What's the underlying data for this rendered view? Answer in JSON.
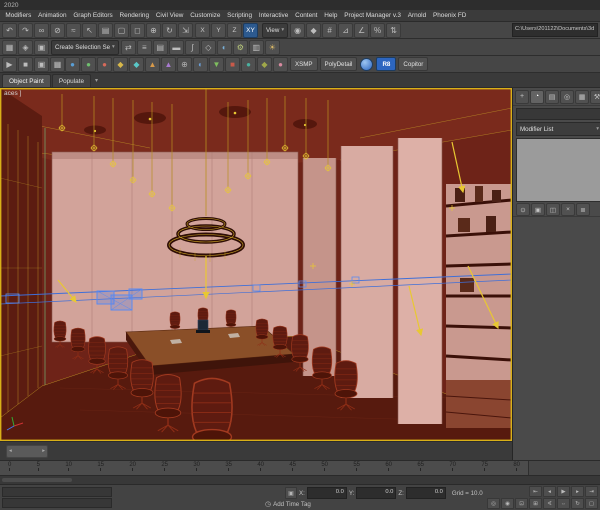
{
  "colors": {
    "viewport_border": "#d8b018",
    "selection_blue": "#4a7de0",
    "light_helper_yellow": "#e8c832",
    "axis_active_blue": "#2d5a8f",
    "wall_red": "#6e2318",
    "wall_pink": "#d2a39a"
  },
  "icons": {
    "chevron_down": "▾",
    "clock": "◷",
    "lock_toggle": "▣"
  },
  "window": {
    "title_fragment": "2020"
  },
  "menubar": {
    "items": [
      {
        "name": "menu-modifiers",
        "label": "Modifiers"
      },
      {
        "name": "menu-animation",
        "label": "Animation"
      },
      {
        "name": "menu-graph-editors",
        "label": "Graph Editors"
      },
      {
        "name": "menu-rendering",
        "label": "Rendering"
      },
      {
        "name": "menu-civil-view",
        "label": "Civil View"
      },
      {
        "name": "menu-customize",
        "label": "Customize"
      },
      {
        "name": "menu-scripting",
        "label": "Scripting"
      },
      {
        "name": "menu-interactive",
        "label": "Interactive"
      },
      {
        "name": "menu-content",
        "label": "Content"
      },
      {
        "name": "menu-help",
        "label": "Help"
      },
      {
        "name": "menu-project-manager",
        "label": "Project Manager v.3"
      },
      {
        "name": "menu-arnold",
        "label": "Arnold"
      },
      {
        "name": "menu-phoenix-fd",
        "label": "Phoenix FD"
      }
    ]
  },
  "toolbar1": {
    "icons_a": [
      {
        "name": "undo-icon",
        "glyph": "↶"
      },
      {
        "name": "redo-icon",
        "glyph": "↷"
      },
      {
        "name": "select-and-link-icon",
        "glyph": "∞"
      },
      {
        "name": "unlink-selection-icon",
        "glyph": "⊘"
      },
      {
        "name": "bind-to-space-warp-icon",
        "glyph": "≈"
      },
      {
        "name": "select-object-icon",
        "glyph": "↖"
      },
      {
        "name": "select-by-name-icon",
        "glyph": "▤"
      },
      {
        "name": "rectangular-selection-icon",
        "glyph": "▢"
      },
      {
        "name": "window-crossing-icon",
        "glyph": "◻"
      },
      {
        "name": "select-and-move-icon",
        "glyph": "⊕"
      },
      {
        "name": "select-and-rotate-icon",
        "glyph": "↻"
      },
      {
        "name": "select-and-scale-icon",
        "glyph": "⇲"
      }
    ],
    "axis_buttons": [
      {
        "name": "axis-constraint-x",
        "label": "X"
      },
      {
        "name": "axis-constraint-y",
        "label": "Y"
      },
      {
        "name": "axis-constraint-z",
        "label": "Z"
      },
      {
        "name": "axis-constraint-xy",
        "label": "XY",
        "active": true
      }
    ],
    "ref_coord_value": "View",
    "icons_b": [
      {
        "name": "use-pivot-point-icon",
        "glyph": "◉"
      },
      {
        "name": "select-and-manipulate-icon",
        "glyph": "◆"
      },
      {
        "name": "keyboard-override-icon",
        "glyph": "#"
      },
      {
        "name": "snaps-toggle-icon",
        "glyph": "⊿"
      },
      {
        "name": "angle-snap-icon",
        "glyph": "∠"
      },
      {
        "name": "percent-snap-icon",
        "glyph": "%"
      },
      {
        "name": "spinner-snap-icon",
        "glyph": "⇅"
      }
    ],
    "project_path": "C:\\Users\\201122\\Documents\\3d"
  },
  "toolbar2": {
    "icons_left": [
      {
        "name": "edit-named-selection-sets-icon",
        "glyph": "▦"
      },
      {
        "name": "isolate-selection-icon",
        "glyph": "◈"
      },
      {
        "name": "lock-selection-icon",
        "glyph": "▣"
      }
    ],
    "selection_set_value": "Create Selection Se",
    "icons_right": [
      {
        "name": "mirror-icon",
        "glyph": "⇄"
      },
      {
        "name": "align-icon",
        "glyph": "≡"
      },
      {
        "name": "layer-manager-icon",
        "glyph": "▤"
      },
      {
        "name": "ribbon-toggle-icon",
        "glyph": "▬"
      },
      {
        "name": "curve-editor-icon",
        "glyph": "∫"
      },
      {
        "name": "schematic-view-icon",
        "glyph": "◇"
      },
      {
        "name": "material-editor-icon",
        "glyph": "◐",
        "color": "#7ab0d8"
      },
      {
        "name": "render-setup-icon",
        "glyph": "⚙",
        "color": "#b8c87a"
      },
      {
        "name": "rendered-frame-window-icon",
        "glyph": "▥"
      },
      {
        "name": "render-production-icon",
        "glyph": "☀",
        "color": "#d8b868"
      }
    ]
  },
  "toolbar3": {
    "icons_left": [
      {
        "name": "play-animation-icon",
        "glyph": "▶"
      },
      {
        "name": "stop-animation-icon",
        "glyph": "■"
      },
      {
        "name": "snapshot-icon",
        "glyph": "▣"
      },
      {
        "name": "grid-toggle-icon",
        "glyph": "▦"
      }
    ],
    "macro_icons": [
      {
        "name": "macro-teapot-blue-icon",
        "glyph": "●",
        "color": "#5a9fd6"
      },
      {
        "name": "macro-teapot-green-icon",
        "glyph": "●",
        "color": "#6fbf6f"
      },
      {
        "name": "macro-teapot-red-icon",
        "glyph": "●",
        "color": "#d66a5a"
      },
      {
        "name": "macro-sphere-yellow-icon",
        "glyph": "◆",
        "color": "#d8b84a"
      },
      {
        "name": "macro-sphere-cyan-icon",
        "glyph": "◆",
        "color": "#5ac8c8"
      },
      {
        "name": "macro-cone-orange-icon",
        "glyph": "▲",
        "color": "#d89a4a"
      },
      {
        "name": "macro-cone-purple-icon",
        "glyph": "▲",
        "color": "#a87ad0"
      },
      {
        "name": "macro-tool-gray-icon",
        "glyph": "⊕",
        "color": "#b0b0b0"
      },
      {
        "name": "macro-tool-blue2-icon",
        "glyph": "◐",
        "color": "#6a9fd8"
      },
      {
        "name": "macro-tool-green2-icon",
        "glyph": "▼",
        "color": "#7fbf5f"
      },
      {
        "name": "macro-tool-red2-icon",
        "glyph": "■",
        "color": "#c85a4a"
      },
      {
        "name": "macro-tool-teal-icon",
        "glyph": "●",
        "color": "#4ab0a0"
      },
      {
        "name": "macro-tool-olive-icon",
        "glyph": "◆",
        "color": "#a0a84a"
      },
      {
        "name": "macro-tool-pink-icon",
        "glyph": "●",
        "color": "#d88aa0"
      }
    ],
    "plugin_buttons": [
      {
        "name": "xsmp-button",
        "label": "XSMP"
      },
      {
        "name": "polydetail-button",
        "label": "PolyDetail"
      }
    ],
    "r8_badge": "R8",
    "copitor_button": "Copitor"
  },
  "ribbon": {
    "tabs": [
      {
        "name": "tab-object-paint",
        "label": "Object Paint",
        "active": true
      },
      {
        "name": "tab-populate",
        "label": "Populate"
      }
    ]
  },
  "viewport": {
    "label": "aces ]"
  },
  "command_panel": {
    "tabs": [
      {
        "name": "create-tab-icon",
        "glyph": "+"
      },
      {
        "name": "modify-tab-icon",
        "glyph": "◔",
        "active": true
      },
      {
        "name": "hierarchy-tab-icon",
        "glyph": "▤"
      },
      {
        "name": "motion-tab-icon",
        "glyph": "◎"
      },
      {
        "name": "display-tab-icon",
        "glyph": "▦"
      },
      {
        "name": "utilities-tab-icon",
        "glyph": "⚒"
      }
    ],
    "modifier_list_label": "Modifier List",
    "stack_buttons": [
      {
        "name": "pin-stack-icon",
        "glyph": "⊙"
      },
      {
        "name": "show-end-result-icon",
        "glyph": "▣"
      },
      {
        "name": "make-unique-icon",
        "glyph": "◫"
      },
      {
        "name": "remove-modifier-icon",
        "glyph": "×"
      },
      {
        "name": "configure-modifier-sets-icon",
        "glyph": "≣"
      }
    ]
  },
  "timeline": {
    "ticks": [
      "0",
      "5",
      "10",
      "15",
      "20",
      "25",
      "30",
      "35",
      "40",
      "45",
      "50",
      "55",
      "60",
      "65",
      "70",
      "75",
      "80"
    ]
  },
  "status": {
    "add_time_tag": "Add Time Tag",
    "x_label": "X:",
    "y_label": "Y:",
    "z_label": "Z:",
    "x_value": "0.0",
    "y_value": "0.0",
    "z_value": "0.0",
    "grid_label": "Grid = 10.0",
    "time_slider_left_arrow": "◂",
    "time_slider_right_arrow": "▸",
    "playback": [
      {
        "name": "go-to-start-button",
        "glyph": "⇤"
      },
      {
        "name": "previous-frame-button",
        "glyph": "◂"
      },
      {
        "name": "play-button",
        "glyph": "▶"
      },
      {
        "name": "next-frame-button",
        "glyph": "▸"
      },
      {
        "name": "go-to-end-button",
        "glyph": "⇥"
      }
    ],
    "nav": [
      {
        "name": "zoom-icon",
        "glyph": "◎"
      },
      {
        "name": "zoom-all-icon",
        "glyph": "◉"
      },
      {
        "name": "zoom-extents-icon",
        "glyph": "⊡"
      },
      {
        "name": "zoom-extents-all-icon",
        "glyph": "⊞"
      },
      {
        "name": "field-of-view-icon",
        "glyph": "∢"
      },
      {
        "name": "pan-icon",
        "glyph": "⇔"
      },
      {
        "name": "orbit-icon",
        "glyph": "↻"
      },
      {
        "name": "maximize-viewport-icon",
        "glyph": "▢"
      }
    ]
  }
}
